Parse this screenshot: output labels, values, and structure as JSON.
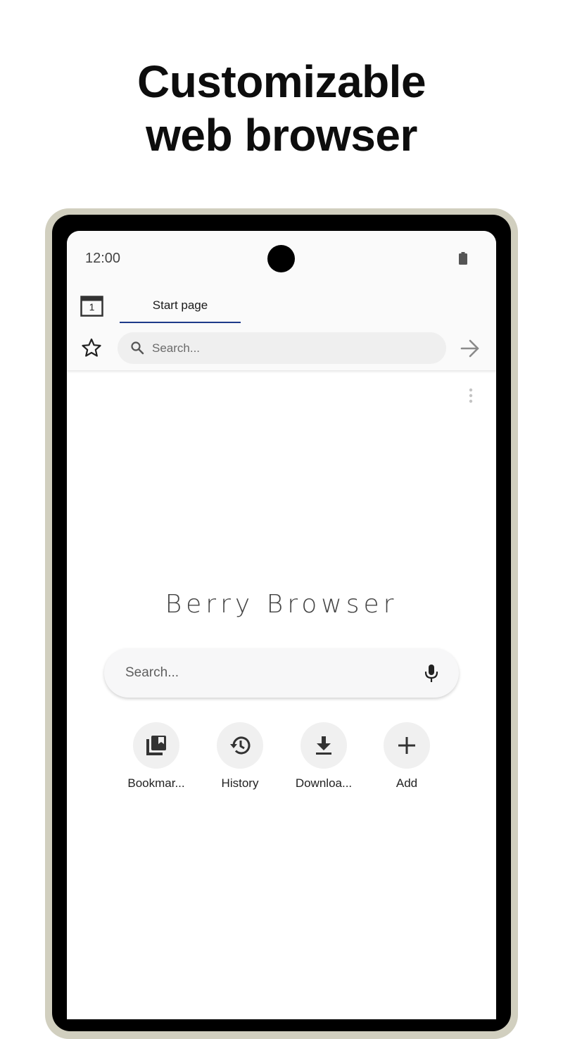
{
  "headline": {
    "line1": "Customizable",
    "line2": "web browser"
  },
  "status_bar": {
    "time": "12:00"
  },
  "tab_bar": {
    "tab_count": "1",
    "active_tab_label": "Start page"
  },
  "address_bar": {
    "placeholder": "Search..."
  },
  "start_page": {
    "brand": "Berry Browser",
    "search_placeholder": "Search..."
  },
  "shortcuts": [
    {
      "label": "Bookmar...",
      "icon": "bookmarks-icon"
    },
    {
      "label": "History",
      "icon": "history-icon"
    },
    {
      "label": "Downloa...",
      "icon": "download-icon"
    },
    {
      "label": "Add",
      "icon": "add-icon"
    }
  ],
  "colors": {
    "tab_underline": "#1e3a8a",
    "phone_frame": "#d1cfbf"
  }
}
